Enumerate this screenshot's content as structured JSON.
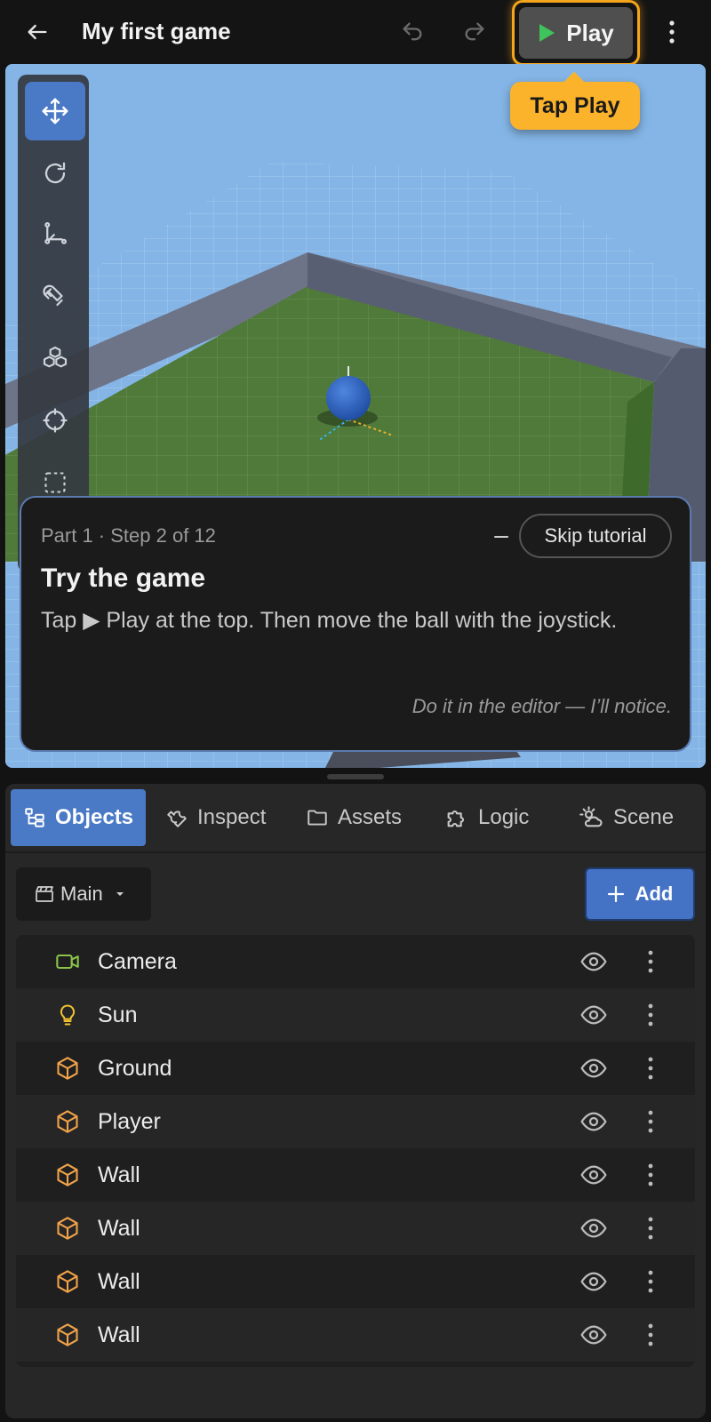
{
  "header": {
    "title": "My first game",
    "play_label": "Play",
    "tooltip": "Tap Play",
    "icons": [
      "back-arrow-icon",
      "undo-icon",
      "redo-icon",
      "play-icon",
      "more-vertical-icon"
    ],
    "accent_color": "#f4a51c",
    "play_icon_color": "#3fc35b"
  },
  "toolbox": {
    "tools": [
      "move-icon",
      "rotate-icon",
      "scale-icon",
      "magnet-icon",
      "cubes-icon",
      "crosshair-icon",
      "select-box-icon"
    ],
    "active_tool": "move-icon",
    "active_color": "#4a79c6"
  },
  "tutorial": {
    "step": "Part 1 · Step 2 of 12",
    "minimize_label": "–",
    "skip_label": "Skip tutorial",
    "title": "Try the game",
    "body": "Tap ▶ Play at the top. Then move the ball with the joystick.",
    "hint": "Do it in the editor — I’ll notice."
  },
  "tabs": [
    {
      "label": "Objects",
      "icon": "tree-icon",
      "active": true
    },
    {
      "label": "Inspect",
      "icon": "wrench-icon",
      "active": false
    },
    {
      "label": "Assets",
      "icon": "folder-icon",
      "active": false
    },
    {
      "label": "Logic",
      "icon": "puzzle-icon",
      "active": false
    },
    {
      "label": "Scene",
      "icon": "weather-icon",
      "active": false
    }
  ],
  "objects_panel": {
    "scene_select": "Main",
    "add_label": "Add",
    "items": [
      {
        "name": "Camera",
        "icon": "camera-icon",
        "icon_color": "#8bc34a"
      },
      {
        "name": "Sun",
        "icon": "bulb-icon",
        "icon_color": "#f2c230"
      },
      {
        "name": "Ground",
        "icon": "cube-icon",
        "icon_color": "#f0a24a"
      },
      {
        "name": "Player",
        "icon": "cube-icon",
        "icon_color": "#f0a24a"
      },
      {
        "name": "Wall",
        "icon": "cube-icon",
        "icon_color": "#f0a24a"
      },
      {
        "name": "Wall",
        "icon": "cube-icon",
        "icon_color": "#f0a24a"
      },
      {
        "name": "Wall",
        "icon": "cube-icon",
        "icon_color": "#f0a24a"
      },
      {
        "name": "Wall",
        "icon": "cube-icon",
        "icon_color": "#f0a24a"
      }
    ]
  }
}
